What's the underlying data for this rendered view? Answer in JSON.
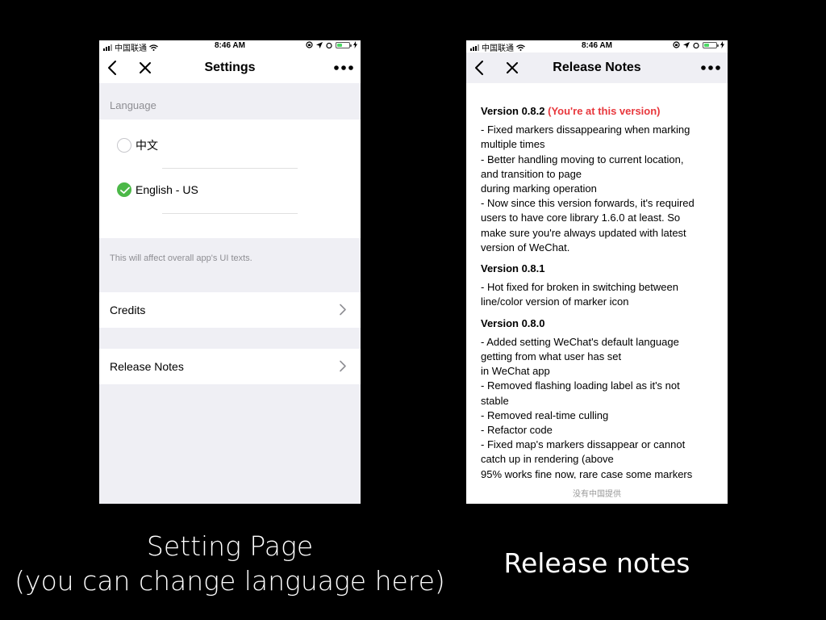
{
  "status_bar": {
    "carrier": "中国联通",
    "time": "8:46 AM"
  },
  "settings_screen": {
    "title": "Settings",
    "language_header": "Language",
    "languages": [
      {
        "label": "中文",
        "selected": false
      },
      {
        "label": "English - US",
        "selected": true
      }
    ],
    "note": "This will affect overall app's UI texts.",
    "menu": [
      {
        "label": "Credits"
      },
      {
        "label": "Release Notes"
      }
    ]
  },
  "release_notes_screen": {
    "title": "Release Notes",
    "versions": [
      {
        "version": "Version 0.8.2",
        "current_tag": "(You're at this version)",
        "lines": [
          "- Fixed markers dissappearing when marking",
          "multiple times",
          "- Better handling moving to current location,",
          "and transition to page",
          "during marking operation",
          "- Now since this version forwards, it's required",
          "users to have core library 1.6.0 at least. So",
          "make sure you're always updated with latest",
          "version of WeChat."
        ]
      },
      {
        "version": "Version 0.8.1",
        "lines": [
          "- Hot fixed for broken in switching between",
          "line/color version of marker icon"
        ]
      },
      {
        "version": "Version 0.8.0",
        "lines": [
          "- Added setting WeChat's default language",
          "getting from what user has set",
          "in WeChat app",
          "- Removed flashing loading label as it's not",
          "stable",
          "- Removed real-time culling",
          "- Refactor code",
          "- Fixed map's markers dissappear or cannot",
          "catch up in rendering (above",
          "95% works fine now, rare case some markers"
        ]
      }
    ],
    "footer": "没有中国提供"
  },
  "captions": {
    "left_line1": "Setting Page",
    "left_line2": "(you can change language here)",
    "right": "Release notes"
  },
  "colors": {
    "check_green": "#4cb848",
    "current_version_red": "#e8383d",
    "background": "#000000"
  },
  "icons": [
    "back-icon",
    "close-icon",
    "more-icon",
    "chevron-right-icon",
    "check-icon",
    "wifi-icon",
    "battery-icon"
  ]
}
